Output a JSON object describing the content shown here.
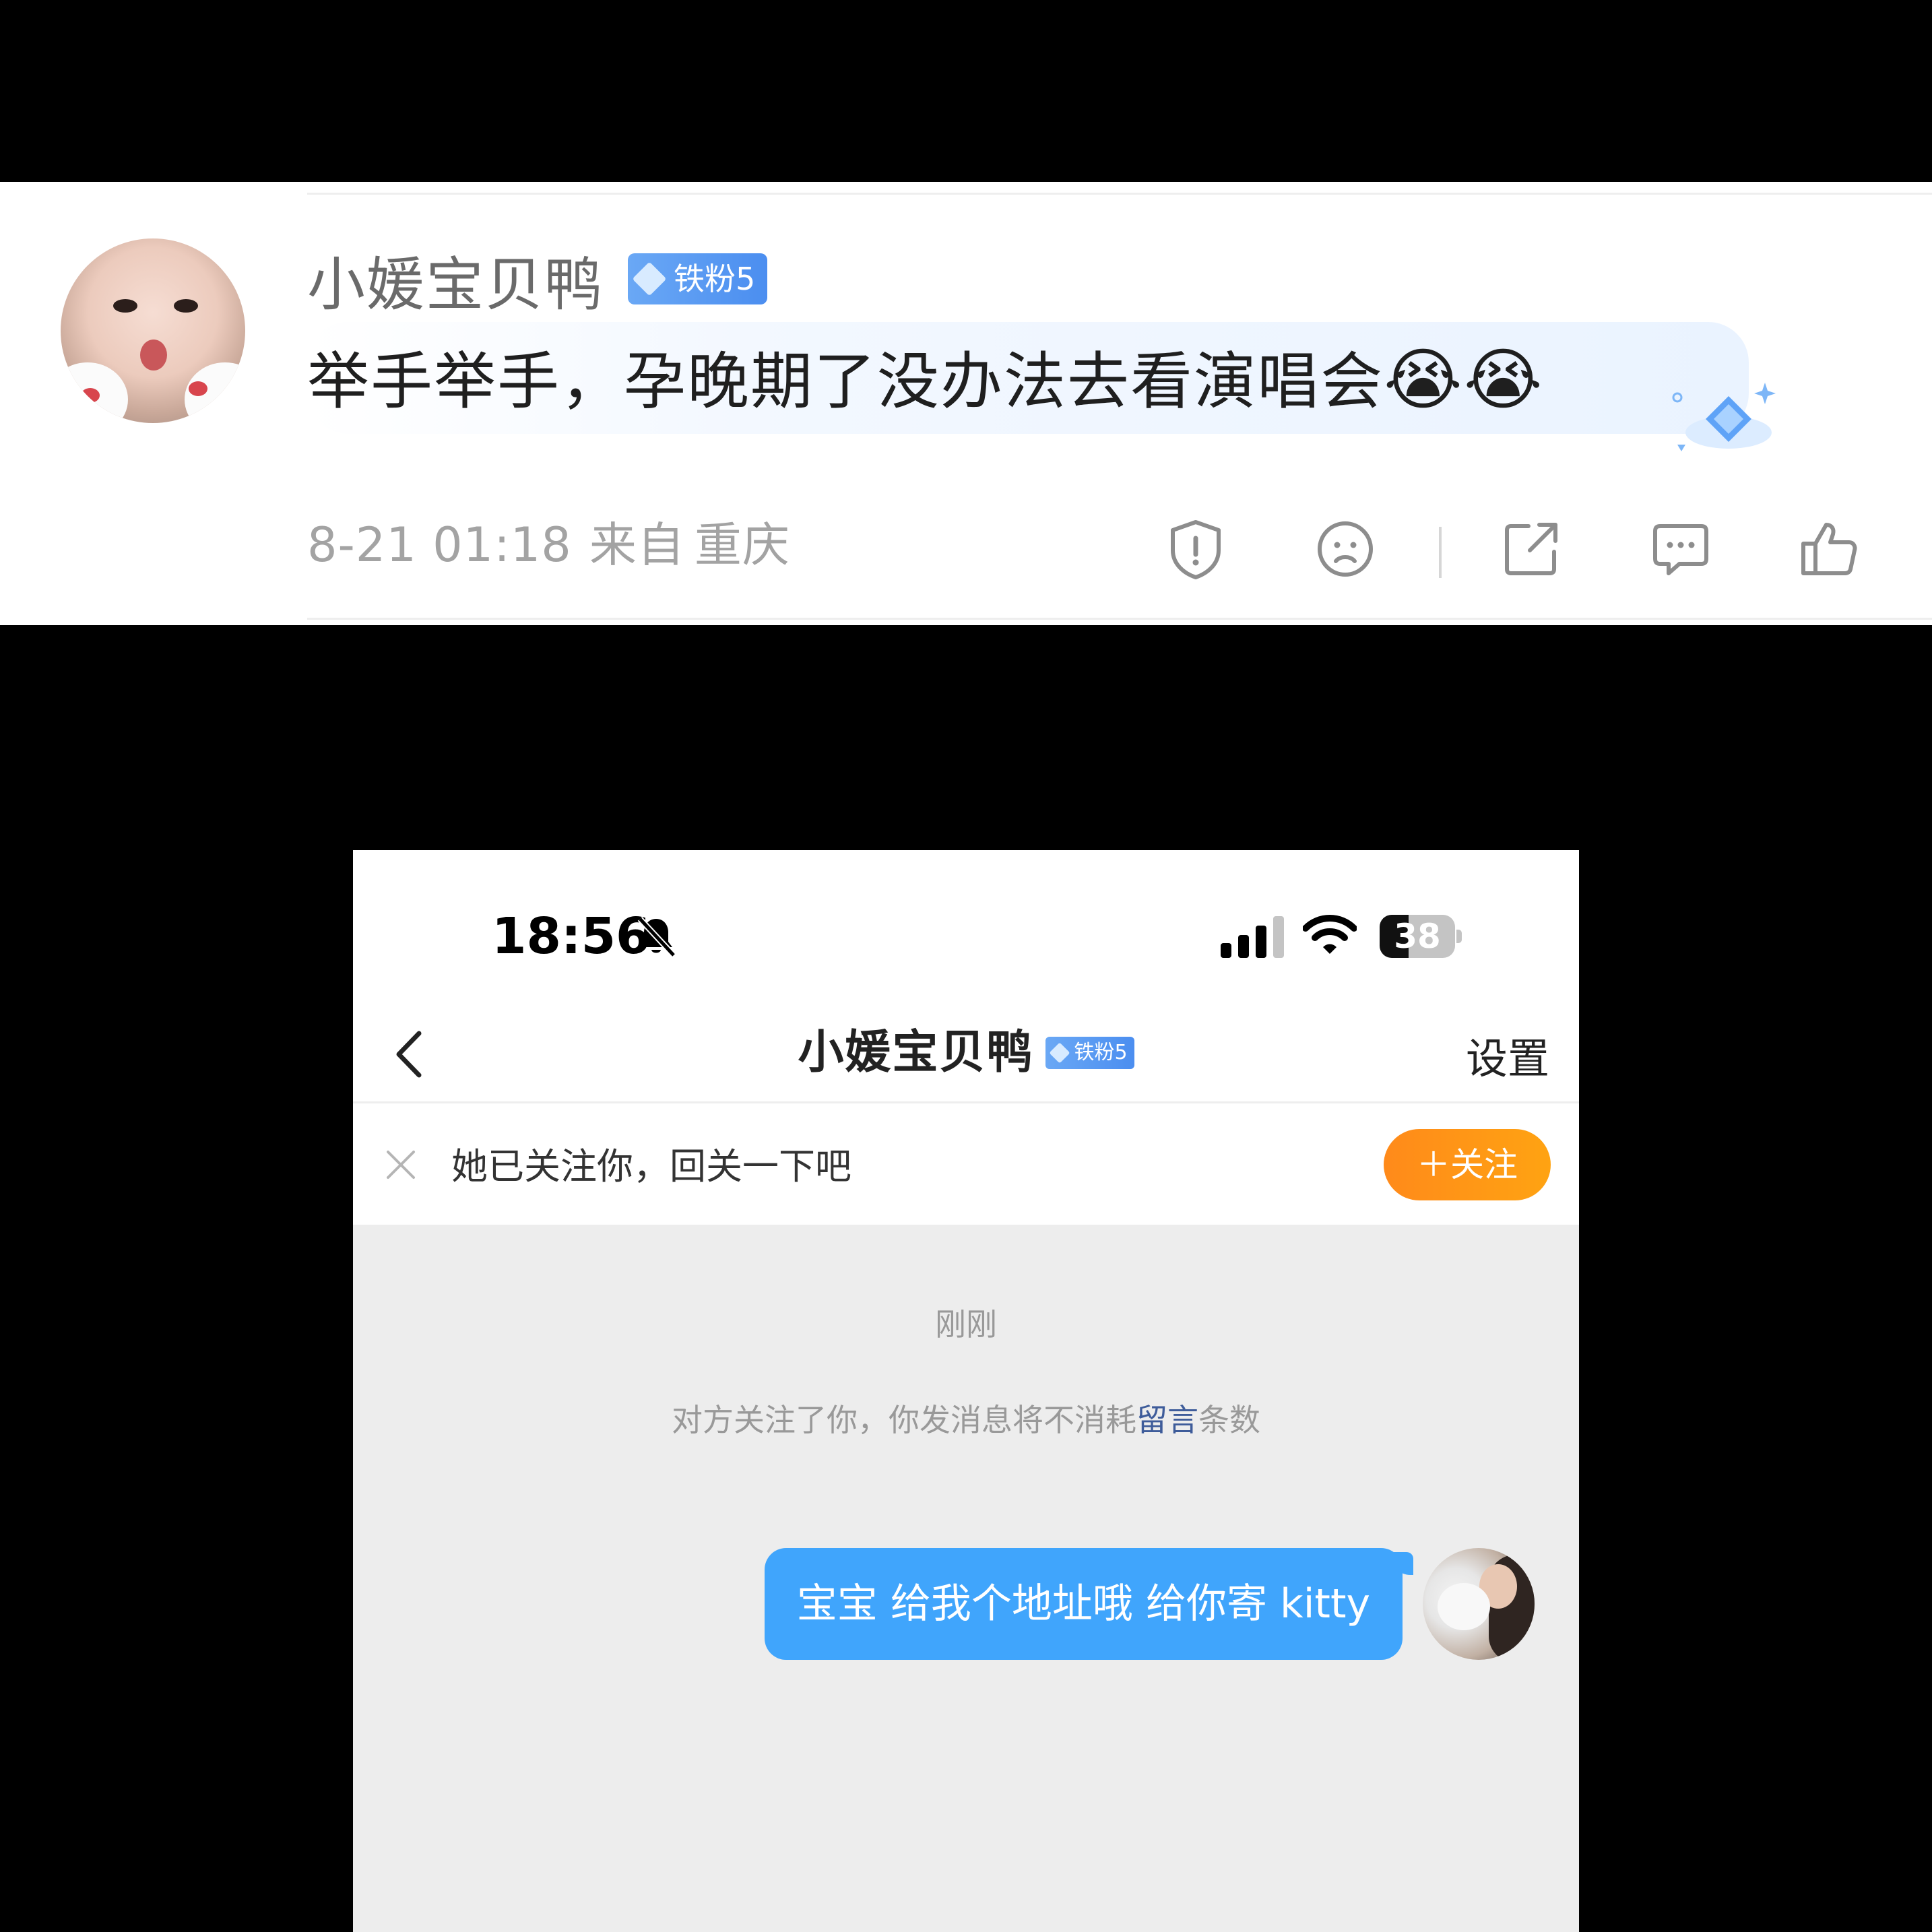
{
  "comment": {
    "username": "小媛宝贝鸭",
    "badge": "铁粉5",
    "text": "举手举手，孕晚期了没办法去看演唱会",
    "emojis": [
      "😭",
      "😭"
    ],
    "date": "8-21 01:18",
    "source_prefix": "来自",
    "location": "重庆",
    "actions": {
      "report": "report-icon",
      "dislike": "sad-face-icon",
      "share": "share-icon",
      "reply": "comment-icon",
      "like": "thumbs-up-icon"
    }
  },
  "phone": {
    "status": {
      "time": "18:56",
      "battery": "38",
      "battery_level": 0.38
    },
    "nav": {
      "title": "小媛宝贝鸭",
      "badge": "铁粉5",
      "settings": "设置"
    },
    "follow_bar": {
      "text": "她已关注你，回关一下吧",
      "button": "＋关注"
    },
    "chat": {
      "time": "刚刚",
      "notice_before": "对方关注了你，你发消息将不消耗",
      "notice_link": "留言",
      "notice_after": "条数",
      "message": "宝宝 给我个地址哦 给你寄 kitty"
    }
  },
  "colors": {
    "accent_blue": "#40a5fc",
    "badge_blue": "#4b8ef0",
    "follow_orange": "#ff8a1a",
    "link_blue": "#3e5c9a"
  }
}
